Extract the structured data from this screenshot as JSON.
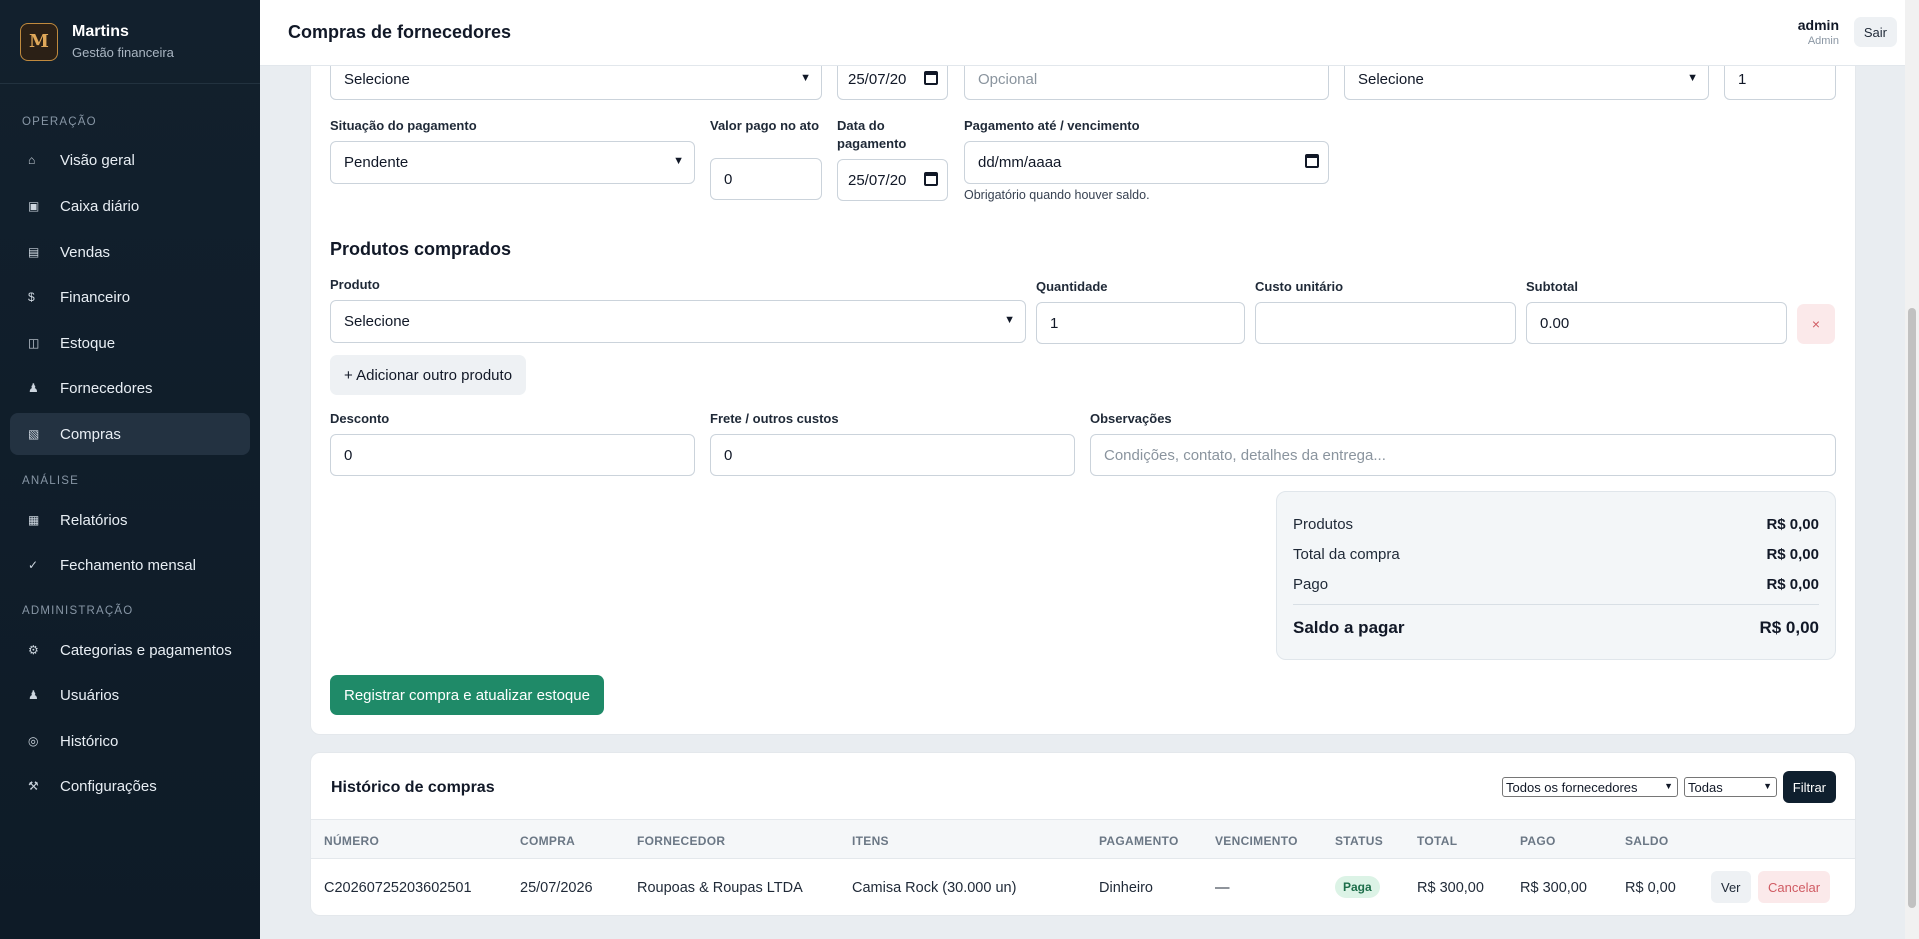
{
  "brand": {
    "name": "Martins",
    "subtitle": "Gestão financeira",
    "logo_text": "M"
  },
  "sidebar": {
    "sections": [
      "OPERAÇÃO",
      "ANÁLISE",
      "ADMINISTRAÇÃO"
    ],
    "items": [
      {
        "label": "Visão geral",
        "icon": "home-icon",
        "glyph": "⌂"
      },
      {
        "label": "Caixa diário",
        "icon": "cash-icon",
        "glyph": "▣"
      },
      {
        "label": "Vendas",
        "icon": "sales-icon",
        "glyph": "▤"
      },
      {
        "label": "Financeiro",
        "icon": "dollar-icon",
        "glyph": "$"
      },
      {
        "label": "Estoque",
        "icon": "stock-icon",
        "glyph": "◫"
      },
      {
        "label": "Fornecedores",
        "icon": "supplier-icon",
        "glyph": "♟"
      },
      {
        "label": "Compras",
        "icon": "purchases-icon",
        "glyph": "▧"
      },
      {
        "label": "Relatórios",
        "icon": "reports-icon",
        "glyph": "▦"
      },
      {
        "label": "Fechamento mensal",
        "icon": "check-icon",
        "glyph": "✓"
      },
      {
        "label": "Categorias e pagamentos",
        "icon": "gear-icon",
        "glyph": "⚙"
      },
      {
        "label": "Usuários",
        "icon": "user-icon",
        "glyph": "♟"
      },
      {
        "label": "Histórico",
        "icon": "history-icon",
        "glyph": "◎"
      },
      {
        "label": "Configurações",
        "icon": "tools-icon",
        "glyph": "⚒"
      }
    ]
  },
  "header": {
    "title": "Compras de fornecedores",
    "user_name": "admin",
    "user_role": "Admin",
    "logout_label": "Sair"
  },
  "form": {
    "top_row": {
      "supplier_value": "Selecione",
      "date_value": "25/07/20",
      "optional_placeholder": "Opcional",
      "method_value": "Selecione",
      "installments_value": "1"
    },
    "payment_status_label": "Situação do pagamento",
    "payment_status_value": "Pendente",
    "paid_now_label": "Valor pago no ato",
    "paid_now_value": "0",
    "payment_date_label": "Data do pagamento",
    "payment_date_value": "25/07/20",
    "due_label": "Pagamento até / vencimento",
    "due_placeholder": "dd/mm/aaaa",
    "due_help": "Obrigatório quando houver saldo.",
    "products_heading": "Produtos comprados",
    "product_label": "Produto",
    "product_value": "Selecione",
    "qty_label": "Quantidade",
    "qty_value": "1",
    "unit_cost_label": "Custo unitário",
    "unit_cost_value": "",
    "subtotal_label": "Subtotal",
    "subtotal_value": "0.00",
    "remove_label": "×",
    "add_product_label": "+ Adicionar outro produto",
    "discount_label": "Desconto",
    "discount_value": "0",
    "freight_label": "Frete / outros custos",
    "freight_value": "0",
    "notes_label": "Observações",
    "notes_placeholder": "Condições, contato, detalhes da entrega...",
    "submit_label": "Registrar compra e atualizar estoque"
  },
  "summary": {
    "products_label": "Produtos",
    "products_value": "R$ 0,00",
    "total_label": "Total da compra",
    "total_value": "R$ 0,00",
    "paid_label": "Pago",
    "paid_value": "R$ 0,00",
    "balance_label": "Saldo a pagar",
    "balance_value": "R$ 0,00"
  },
  "history": {
    "title": "Histórico de compras",
    "supplier_filter": "Todos os fornecedores",
    "status_filter": "Todas",
    "filter_label": "Filtrar",
    "columns": [
      "NÚMERO",
      "COMPRA",
      "FORNECEDOR",
      "ITENS",
      "PAGAMENTO",
      "VENCIMENTO",
      "STATUS",
      "TOTAL",
      "PAGO",
      "SALDO"
    ],
    "rows": [
      {
        "number": "C20260725203602501",
        "date": "25/07/2026",
        "supplier": "Roupoas & Roupas LTDA",
        "items": "Camisa Rock (30.000 un)",
        "payment": "Dinheiro",
        "due": "—",
        "status": "Paga",
        "total": "R$ 300,00",
        "paid": "R$ 300,00",
        "balance": "R$ 0,00",
        "view_label": "Ver",
        "cancel_label": "Cancelar"
      }
    ]
  },
  "colors": {
    "sidebar_bg": "#12202d",
    "primary": "#1f8a68",
    "danger": "#d05b63",
    "paid_badge_bg": "#dcf3e6"
  }
}
